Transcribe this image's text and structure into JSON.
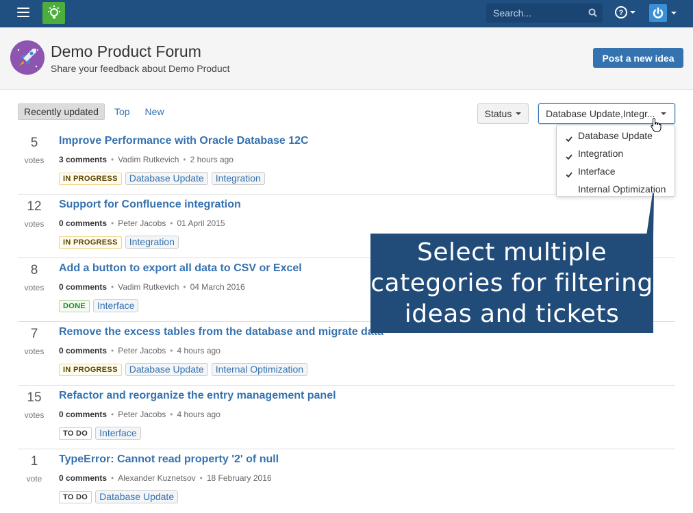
{
  "nav": {
    "search_placeholder": "Search..."
  },
  "header": {
    "title": "Demo Product Forum",
    "subtitle": "Share your feedback about Demo Product",
    "post_button": "Post a new idea"
  },
  "sort_tabs": [
    "Recently updated",
    "Top",
    "New"
  ],
  "filters": {
    "status_label": "Status",
    "category_label": "Database Update,Integr..."
  },
  "category_dropdown": [
    {
      "label": "Database Update",
      "checked": true
    },
    {
      "label": "Integration",
      "checked": true
    },
    {
      "label": "Interface",
      "checked": true
    },
    {
      "label": "Internal Optimization",
      "checked": false
    }
  ],
  "callout": {
    "lines": [
      "Select multiple",
      "categories for filtering",
      "ideas and tickets"
    ]
  },
  "ideas": [
    {
      "votes": "5",
      "votes_label": "votes",
      "title": "Improve Performance with Oracle Database 12C",
      "comments": "3 comments",
      "author": "Vadim Rutkevich",
      "time": "2 hours ago",
      "status": "IN PROGRESS",
      "tags": [
        "Database Update",
        "Integration"
      ]
    },
    {
      "votes": "12",
      "votes_label": "votes",
      "title": "Support for Confluence integration",
      "comments": "0 comments",
      "author": "Peter Jacobs",
      "time": "01 April 2015",
      "status": "IN PROGRESS",
      "tags": [
        "Integration"
      ]
    },
    {
      "votes": "8",
      "votes_label": "votes",
      "title": "Add a button to export all data to CSV or Excel",
      "comments": "0 comments",
      "author": "Vadim Rutkevich",
      "time": "04 March 2016",
      "status": "DONE",
      "tags": [
        "Interface"
      ]
    },
    {
      "votes": "7",
      "votes_label": "votes",
      "title": "Remove the excess tables from the database and migrate data",
      "comments": "0 comments",
      "author": "Peter Jacobs",
      "time": "4 hours ago",
      "status": "IN PROGRESS",
      "tags": [
        "Database Update",
        "Internal Optimization"
      ]
    },
    {
      "votes": "15",
      "votes_label": "votes",
      "title": "Refactor and reorganize the entry management panel",
      "comments": "0 comments",
      "author": "Peter Jacobs",
      "time": "4 hours ago",
      "status": "TO DO",
      "tags": [
        "Interface"
      ]
    },
    {
      "votes": "1",
      "votes_label": "vote",
      "title": "TypeError: Cannot read property '2' of null",
      "comments": "0 comments",
      "author": "Alexander Kuznetsov",
      "time": "18 February 2016",
      "status": "TO DO",
      "tags": [
        "Database Update"
      ]
    }
  ]
}
